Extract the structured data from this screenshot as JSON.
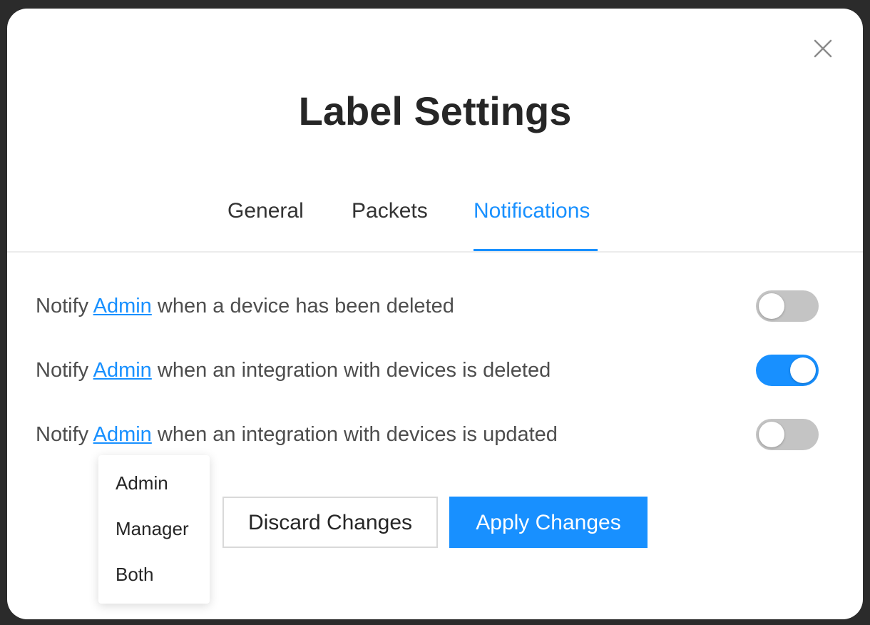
{
  "modal": {
    "title": "Label Settings",
    "close_icon": "close-icon"
  },
  "tabs": [
    {
      "label": "General",
      "active": false
    },
    {
      "label": "Packets",
      "active": false
    },
    {
      "label": "Notifications",
      "active": true
    }
  ],
  "notifications": [
    {
      "prefix": "Notify",
      "role": "Admin",
      "suffix": "when a device has been deleted",
      "enabled": false
    },
    {
      "prefix": "Notify",
      "role": "Admin",
      "suffix": "when an integration with devices is deleted",
      "enabled": true
    },
    {
      "prefix": "Notify",
      "role": "Admin",
      "suffix": "when an integration with devices is updated",
      "enabled": false
    }
  ],
  "role_dropdown": {
    "open_for_row": 3,
    "options": [
      "Admin",
      "Manager",
      "Both"
    ]
  },
  "buttons": {
    "discard_label": "Discard Changes",
    "apply_label": "Apply Changes"
  },
  "colors": {
    "accent": "#1890ff",
    "toggle_off": "#c4c4c4",
    "backdrop": "#2b2b2b"
  }
}
